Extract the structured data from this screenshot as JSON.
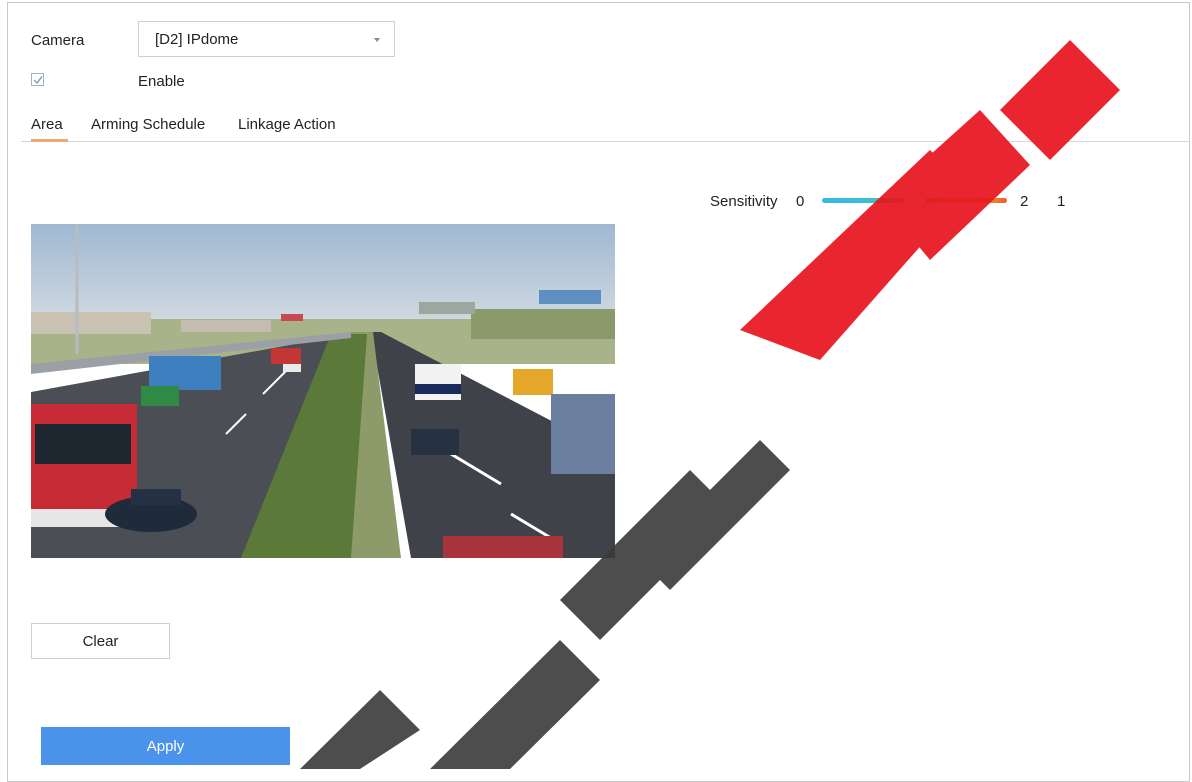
{
  "camera": {
    "label": "Camera",
    "value": "[D2] IPdome"
  },
  "enable": {
    "label": "Enable",
    "checked": true
  },
  "tabs": [
    {
      "label": "Area",
      "active": true
    },
    {
      "label": "Arming Schedule",
      "active": false
    },
    {
      "label": "Linkage Action",
      "active": false
    }
  ],
  "sensitivity": {
    "label": "Sensitivity",
    "min": "0",
    "max": "2",
    "value": "1",
    "level_fraction": 0.5
  },
  "buttons": {
    "clear": "Clear",
    "apply": "Apply"
  },
  "watermark": {
    "text": "...its Net"
  },
  "colors": {
    "accent": "#4b93ea",
    "tab_underline": "#f0a678",
    "watermark_red": "#e8141e",
    "watermark_gray": "#3a3a3a"
  }
}
